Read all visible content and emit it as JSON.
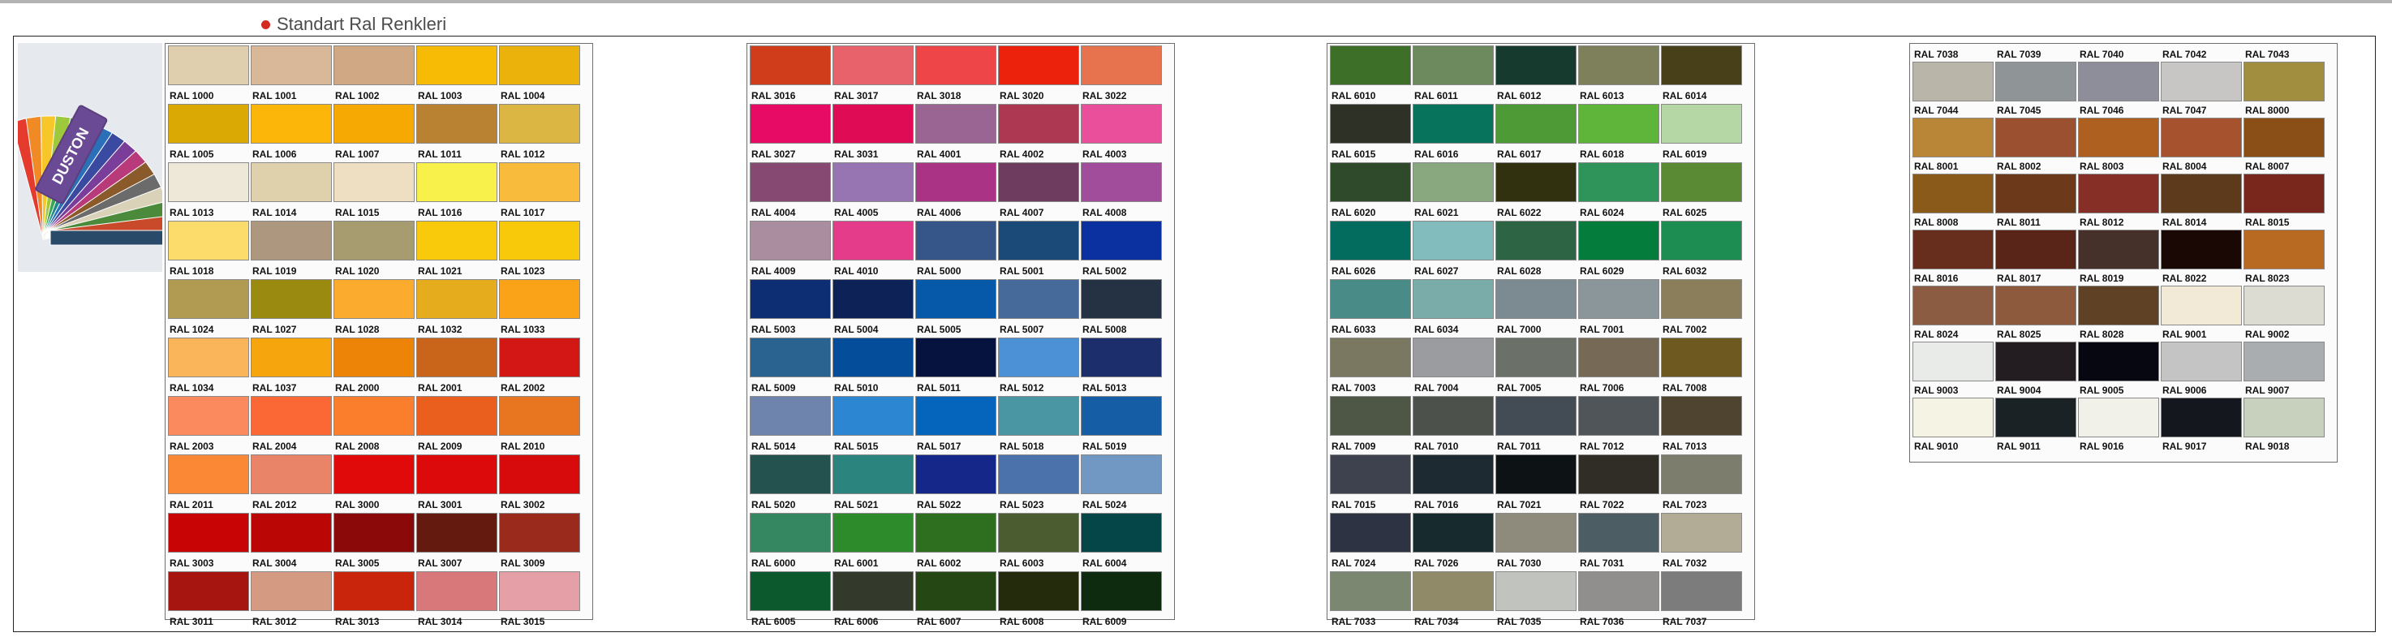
{
  "header": {
    "title": "Standart Ral Renkleri"
  },
  "fan_image": {
    "brand": "DUSTON"
  },
  "panels": [
    {
      "label_position": "below",
      "colors": [
        {
          "code": "RAL 1000",
          "hex": "#dfcfae"
        },
        {
          "code": "RAL 1001",
          "hex": "#d9b89a"
        },
        {
          "code": "RAL 1002",
          "hex": "#d1a884"
        },
        {
          "code": "RAL 1003",
          "hex": "#f8bb05"
        },
        {
          "code": "RAL 1004",
          "hex": "#eab20b"
        },
        {
          "code": "RAL 1005",
          "hex": "#dba904"
        },
        {
          "code": "RAL 1006",
          "hex": "#fbb609"
        },
        {
          "code": "RAL 1007",
          "hex": "#f6a902"
        },
        {
          "code": "RAL 1011",
          "hex": "#b98233"
        },
        {
          "code": "RAL 1012",
          "hex": "#dbb643"
        },
        {
          "code": "RAL 1013",
          "hex": "#eee8d9"
        },
        {
          "code": "RAL 1014",
          "hex": "#ded1ac"
        },
        {
          "code": "RAL 1015",
          "hex": "#eedfc2"
        },
        {
          "code": "RAL 1016",
          "hex": "#f8f04b"
        },
        {
          "code": "RAL 1017",
          "hex": "#f9bb3b"
        },
        {
          "code": "RAL 1018",
          "hex": "#fcdd6c"
        },
        {
          "code": "RAL 1019",
          "hex": "#ad977e"
        },
        {
          "code": "RAL 1020",
          "hex": "#a69c70"
        },
        {
          "code": "RAL 1021",
          "hex": "#f9c90b"
        },
        {
          "code": "RAL 1023",
          "hex": "#f8c90b"
        },
        {
          "code": "RAL 1024",
          "hex": "#b19a51"
        },
        {
          "code": "RAL 1027",
          "hex": "#9b8a10"
        },
        {
          "code": "RAL 1028",
          "hex": "#fbab2d"
        },
        {
          "code": "RAL 1032",
          "hex": "#e5ac1e"
        },
        {
          "code": "RAL 1033",
          "hex": "#fba318"
        },
        {
          "code": "RAL 1034",
          "hex": "#fab55b"
        },
        {
          "code": "RAL 1037",
          "hex": "#f6a60c"
        },
        {
          "code": "RAL 2000",
          "hex": "#ed8307"
        },
        {
          "code": "RAL 2001",
          "hex": "#c9641b"
        },
        {
          "code": "RAL 2002",
          "hex": "#d31714"
        },
        {
          "code": "RAL 2003",
          "hex": "#fb8a5f"
        },
        {
          "code": "RAL 2004",
          "hex": "#fb6735"
        },
        {
          "code": "RAL 2008",
          "hex": "#fb7e2c"
        },
        {
          "code": "RAL 2009",
          "hex": "#ea5e1e"
        },
        {
          "code": "RAL 2010",
          "hex": "#e8751f"
        },
        {
          "code": "RAL 2011",
          "hex": "#fb8835"
        },
        {
          "code": "RAL 2012",
          "hex": "#ea8468"
        },
        {
          "code": "RAL 3000",
          "hex": "#e00a0a"
        },
        {
          "code": "RAL 3001",
          "hex": "#dd0a0b"
        },
        {
          "code": "RAL 3002",
          "hex": "#d70b0b"
        },
        {
          "code": "RAL 3003",
          "hex": "#c80404"
        },
        {
          "code": "RAL 3004",
          "hex": "#bb0606"
        },
        {
          "code": "RAL 3005",
          "hex": "#8c0909"
        },
        {
          "code": "RAL 3007",
          "hex": "#651a0f"
        },
        {
          "code": "RAL 3009",
          "hex": "#9a2a1b"
        },
        {
          "code": "RAL 3011",
          "hex": "#a71510"
        },
        {
          "code": "RAL 3012",
          "hex": "#d49a82"
        },
        {
          "code": "RAL 3013",
          "hex": "#c9250d"
        },
        {
          "code": "RAL 3014",
          "hex": "#d9787b"
        },
        {
          "code": "RAL 3015",
          "hex": "#e4a0a6"
        }
      ]
    },
    {
      "label_position": "below",
      "colors": [
        {
          "code": "RAL 3016",
          "hex": "#cf3d1b"
        },
        {
          "code": "RAL 3017",
          "hex": "#e7626a"
        },
        {
          "code": "RAL 3018",
          "hex": "#ee4549"
        },
        {
          "code": "RAL 3020",
          "hex": "#ed220c"
        },
        {
          "code": "RAL 3022",
          "hex": "#e7734e"
        },
        {
          "code": "RAL 3027",
          "hex": "#e80b65"
        },
        {
          "code": "RAL 3031",
          "hex": "#df0b55"
        },
        {
          "code": "RAL 4001",
          "hex": "#9a6593"
        },
        {
          "code": "RAL 4002",
          "hex": "#ac3851"
        },
        {
          "code": "RAL 4003",
          "hex": "#ea4f9c"
        },
        {
          "code": "RAL 4004",
          "hex": "#864a72"
        },
        {
          "code": "RAL 4005",
          "hex": "#9675b2"
        },
        {
          "code": "RAL 4006",
          "hex": "#ab3385"
        },
        {
          "code": "RAL 4007",
          "hex": "#6e3c5f"
        },
        {
          "code": "RAL 4008",
          "hex": "#a24c9c"
        },
        {
          "code": "RAL 4009",
          "hex": "#aa8e9f"
        },
        {
          "code": "RAL 4010",
          "hex": "#e53b8b"
        },
        {
          "code": "RAL 5000",
          "hex": "#36568a"
        },
        {
          "code": "RAL 5001",
          "hex": "#1b4a78"
        },
        {
          "code": "RAL 5002",
          "hex": "#0b31a0"
        },
        {
          "code": "RAL 5003",
          "hex": "#0e2e74"
        },
        {
          "code": "RAL 5004",
          "hex": "#0d2256"
        },
        {
          "code": "RAL 5005",
          "hex": "#0559a8"
        },
        {
          "code": "RAL 5007",
          "hex": "#466a99"
        },
        {
          "code": "RAL 5008",
          "hex": "#253244"
        },
        {
          "code": "RAL 5009",
          "hex": "#2b6390"
        },
        {
          "code": "RAL 5010",
          "hex": "#044d9a"
        },
        {
          "code": "RAL 5011",
          "hex": "#06133f"
        },
        {
          "code": "RAL 5012",
          "hex": "#4c91d6"
        },
        {
          "code": "RAL 5013",
          "hex": "#1c2e6b"
        },
        {
          "code": "RAL 5014",
          "hex": "#6f84ad"
        },
        {
          "code": "RAL 5015",
          "hex": "#2c86d1"
        },
        {
          "code": "RAL 5017",
          "hex": "#0565bc"
        },
        {
          "code": "RAL 5018",
          "hex": "#4a96a2"
        },
        {
          "code": "RAL 5019",
          "hex": "#155da5"
        },
        {
          "code": "RAL 5020",
          "hex": "#24524e"
        },
        {
          "code": "RAL 5021",
          "hex": "#2c847e"
        },
        {
          "code": "RAL 5022",
          "hex": "#152788"
        },
        {
          "code": "RAL 5023",
          "hex": "#4b72aa"
        },
        {
          "code": "RAL 5024",
          "hex": "#7098c2"
        },
        {
          "code": "RAL 6000",
          "hex": "#358761"
        },
        {
          "code": "RAL 6001",
          "hex": "#2d8b2c"
        },
        {
          "code": "RAL 6002",
          "hex": "#2e6f1f"
        },
        {
          "code": "RAL 6003",
          "hex": "#4a5c30"
        },
        {
          "code": "RAL 6004",
          "hex": "#054648"
        },
        {
          "code": "RAL 6005",
          "hex": "#0b592d"
        },
        {
          "code": "RAL 6006",
          "hex": "#333a2c"
        },
        {
          "code": "RAL 6007",
          "hex": "#244714"
        },
        {
          "code": "RAL 6008",
          "hex": "#242a0c"
        },
        {
          "code": "RAL 6009",
          "hex": "#0e2b0f"
        }
      ]
    },
    {
      "label_position": "below",
      "colors": [
        {
          "code": "RAL 6010",
          "hex": "#3d6f28"
        },
        {
          "code": "RAL 6011",
          "hex": "#6c8a5e"
        },
        {
          "code": "RAL 6012",
          "hex": "#173a2f"
        },
        {
          "code": "RAL 6013",
          "hex": "#7d805b"
        },
        {
          "code": "RAL 6014",
          "hex": "#474019"
        },
        {
          "code": "RAL 6015",
          "hex": "#2d3126"
        },
        {
          "code": "RAL 6016",
          "hex": "#08735c"
        },
        {
          "code": "RAL 6017",
          "hex": "#4d9a37"
        },
        {
          "code": "RAL 6018",
          "hex": "#5eb53a"
        },
        {
          "code": "RAL 6019",
          "hex": "#b4d7a5"
        },
        {
          "code": "RAL 6020",
          "hex": "#2e4a2b"
        },
        {
          "code": "RAL 6021",
          "hex": "#8aa880"
        },
        {
          "code": "RAL 6022",
          "hex": "#32310f"
        },
        {
          "code": "RAL 6024",
          "hex": "#2f9459"
        },
        {
          "code": "RAL 6025",
          "hex": "#5a8a33"
        },
        {
          "code": "RAL 6026",
          "hex": "#046b5f"
        },
        {
          "code": "RAL 6027",
          "hex": "#82bcbc"
        },
        {
          "code": "RAL 6028",
          "hex": "#2d6443"
        },
        {
          "code": "RAL 6029",
          "hex": "#047c3c"
        },
        {
          "code": "RAL 6032",
          "hex": "#1e8d52"
        },
        {
          "code": "RAL 6033",
          "hex": "#498c87"
        },
        {
          "code": "RAL 6034",
          "hex": "#7aadaa"
        },
        {
          "code": "RAL 7000",
          "hex": "#7c8b92"
        },
        {
          "code": "RAL 7001",
          "hex": "#8b969b"
        },
        {
          "code": "RAL 7002",
          "hex": "#8a7e5b"
        },
        {
          "code": "RAL 7003",
          "hex": "#7a7860"
        },
        {
          "code": "RAL 7004",
          "hex": "#9b9c9f"
        },
        {
          "code": "RAL 7005",
          "hex": "#6b7068"
        },
        {
          "code": "RAL 7006",
          "hex": "#766a56"
        },
        {
          "code": "RAL 7008",
          "hex": "#6e5a20"
        },
        {
          "code": "RAL 7009",
          "hex": "#4e5646"
        },
        {
          "code": "RAL 7010",
          "hex": "#4c514c"
        },
        {
          "code": "RAL 7011",
          "hex": "#434c54"
        },
        {
          "code": "RAL 7012",
          "hex": "#4f5559"
        },
        {
          "code": "RAL 7013",
          "hex": "#4f4430"
        },
        {
          "code": "RAL 7015",
          "hex": "#3d424e"
        },
        {
          "code": "RAL 7016",
          "hex": "#1e2a32"
        },
        {
          "code": "RAL 7021",
          "hex": "#0d1214"
        },
        {
          "code": "RAL 7022",
          "hex": "#302d26"
        },
        {
          "code": "RAL 7023",
          "hex": "#7c7d6d"
        },
        {
          "code": "RAL 7024",
          "hex": "#2e3344"
        },
        {
          "code": "RAL 7026",
          "hex": "#172b2e"
        },
        {
          "code": "RAL 7030",
          "hex": "#8e8a7c"
        },
        {
          "code": "RAL 7031",
          "hex": "#4c5e64"
        },
        {
          "code": "RAL 7032",
          "hex": "#b2ab96"
        },
        {
          "code": "RAL 7033",
          "hex": "#7b8771"
        },
        {
          "code": "RAL 7034",
          "hex": "#908a69"
        },
        {
          "code": "RAL 7035",
          "hex": "#c1c3bf"
        },
        {
          "code": "RAL 7036",
          "hex": "#918e8e"
        },
        {
          "code": "RAL 7037",
          "hex": "#7b7c7b"
        }
      ]
    },
    {
      "label_position": "above",
      "colors": [
        {
          "code": "RAL 7038",
          "hex": "#b9b5a9"
        },
        {
          "code": "RAL 7039",
          "hex": "#8f9497"
        },
        {
          "code": "RAL 7040",
          "hex": "#8d8e99"
        },
        {
          "code": "RAL 7042",
          "hex": "#c8c5c5"
        },
        {
          "code": "RAL 7043",
          "hex": "#a28e3f"
        },
        {
          "code": "RAL 7044",
          "hex": "#b98536"
        },
        {
          "code": "RAL 7045",
          "hex": "#9b5030"
        },
        {
          "code": "RAL 7046",
          "hex": "#ae6021"
        },
        {
          "code": "RAL 7047",
          "hex": "#a7522e"
        },
        {
          "code": "RAL 8000",
          "hex": "#8a4f17"
        },
        {
          "code": "RAL 8001",
          "hex": "#8a5a1a"
        },
        {
          "code": "RAL 8002",
          "hex": "#6d391b"
        },
        {
          "code": "RAL 8003",
          "hex": "#852f27"
        },
        {
          "code": "RAL 8004",
          "hex": "#5c3a1b"
        },
        {
          "code": "RAL 8007",
          "hex": "#79271d"
        },
        {
          "code": "RAL 8008",
          "hex": "#672e1d"
        },
        {
          "code": "RAL 8011",
          "hex": "#5a2519"
        },
        {
          "code": "RAL 8012",
          "hex": "#45302a"
        },
        {
          "code": "RAL 8014",
          "hex": "#1a0804"
        },
        {
          "code": "RAL 8015",
          "hex": "#b86a22"
        },
        {
          "code": "RAL 8016",
          "hex": "#8c5c42"
        },
        {
          "code": "RAL 8017",
          "hex": "#8d5a3d"
        },
        {
          "code": "RAL 8019",
          "hex": "#5f4125"
        },
        {
          "code": "RAL 8022",
          "hex": "#f2e9d6"
        },
        {
          "code": "RAL 8023",
          "hex": "#dcdcd2"
        },
        {
          "code": "RAL 8024",
          "hex": "#e9ebe9"
        },
        {
          "code": "RAL 8025",
          "hex": "#231d22"
        },
        {
          "code": "RAL 8028",
          "hex": "#060710"
        },
        {
          "code": "RAL 9001",
          "hex": "#c4c4c4"
        },
        {
          "code": "RAL 9002",
          "hex": "#a9adb0"
        },
        {
          "code": "RAL 9003",
          "hex": "#f5f3e3"
        },
        {
          "code": "RAL 9004",
          "hex": "#1a2226"
        },
        {
          "code": "RAL 9005",
          "hex": "#f1f1ea"
        },
        {
          "code": "RAL 9006",
          "hex": "#15171e"
        },
        {
          "code": "RAL 9007",
          "hex": "#c8d0be"
        }
      ],
      "trailing_labels": [
        "RAL 9010",
        "RAL 9011",
        "RAL 9016",
        "RAL 9017",
        "RAL 9018"
      ]
    }
  ]
}
